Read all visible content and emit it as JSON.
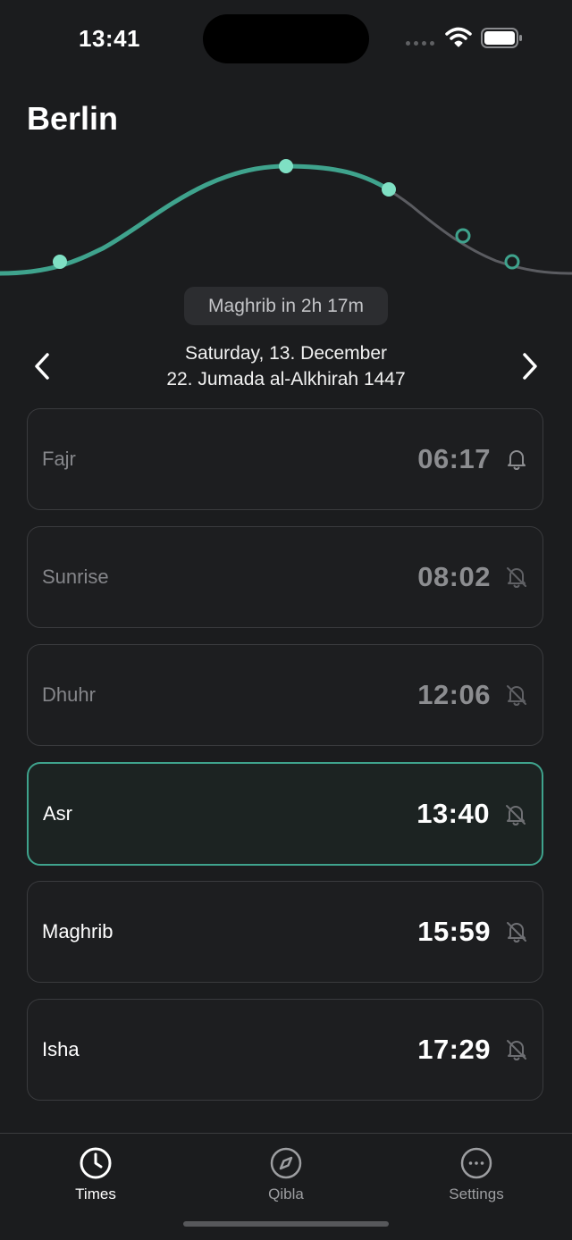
{
  "status_bar": {
    "time": "13:41"
  },
  "header": {
    "city": "Berlin"
  },
  "countdown": "Maghrib in 2h 17m",
  "date": {
    "gregorian": "Saturday, 13. December",
    "hijri": "22. Jumada al-Alkhirah 1447"
  },
  "prayers": [
    {
      "name": "Fajr",
      "time": "06:17",
      "state": "past",
      "notification": "on"
    },
    {
      "name": "Sunrise",
      "time": "08:02",
      "state": "past",
      "notification": "off"
    },
    {
      "name": "Dhuhr",
      "time": "12:06",
      "state": "past",
      "notification": "off"
    },
    {
      "name": "Asr",
      "time": "13:40",
      "state": "current",
      "notification": "off"
    },
    {
      "name": "Maghrib",
      "time": "15:59",
      "state": "upcoming",
      "notification": "off"
    },
    {
      "name": "Isha",
      "time": "17:29",
      "state": "upcoming",
      "notification": "off"
    }
  ],
  "tabs": [
    {
      "label": "Times",
      "icon": "clock-icon",
      "selected": true
    },
    {
      "label": "Qibla",
      "icon": "compass-icon",
      "selected": false
    },
    {
      "label": "Settings",
      "icon": "ellipsis-circle-icon",
      "selected": false
    }
  ],
  "colors": {
    "accent": "#3fa38d",
    "accent_light": "#7fe0c4",
    "background": "#1b1c1e"
  }
}
